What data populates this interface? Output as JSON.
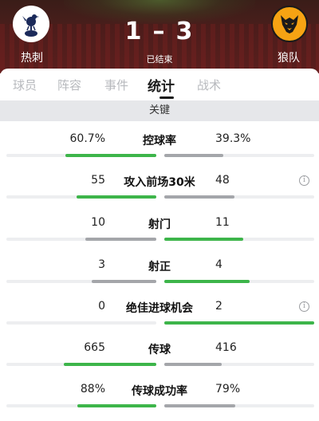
{
  "match": {
    "home_team": "热刺",
    "away_team": "狼队",
    "home_score": "1",
    "away_score": "3",
    "separator": "–",
    "status": "已结束"
  },
  "tabs": [
    {
      "label": "球员",
      "active": false
    },
    {
      "label": "阵容",
      "active": false
    },
    {
      "label": "事件",
      "active": false
    },
    {
      "label": "统计",
      "active": true
    },
    {
      "label": "战术",
      "active": false
    }
  ],
  "section": {
    "title": "关键"
  },
  "colors": {
    "leading": "#3db54a",
    "trailing": "#a4a6aa",
    "track": "#edeef0"
  },
  "stats": [
    {
      "label": "控球率",
      "home": "60.7%",
      "away": "39.3%",
      "home_share": 0.607,
      "away_share": 0.393,
      "leader": "home",
      "info": false
    },
    {
      "label": "攻入前场30米",
      "home": "55",
      "away": "48",
      "home_share": 0.534,
      "away_share": 0.466,
      "leader": "home",
      "info": true
    },
    {
      "label": "射门",
      "home": "10",
      "away": "11",
      "home_share": 0.476,
      "away_share": 0.524,
      "leader": "away",
      "info": false
    },
    {
      "label": "射正",
      "home": "3",
      "away": "4",
      "home_share": 0.429,
      "away_share": 0.571,
      "leader": "away",
      "info": false
    },
    {
      "label": "绝佳进球机会",
      "home": "0",
      "away": "2",
      "home_share": 0.0,
      "away_share": 1.0,
      "leader": "away",
      "info": true
    },
    {
      "label": "传球",
      "home": "665",
      "away": "416",
      "home_share": 0.615,
      "away_share": 0.385,
      "leader": "home",
      "info": false
    },
    {
      "label": "传球成功率",
      "home": "88%",
      "away": "79%",
      "home_share": 0.527,
      "away_share": 0.473,
      "leader": "home",
      "info": false
    }
  ],
  "icons": {
    "home_logo": "tottenham-cockerel-crest",
    "away_logo": "wolves-wolf-head-crest",
    "info": "info-circle-icon"
  }
}
